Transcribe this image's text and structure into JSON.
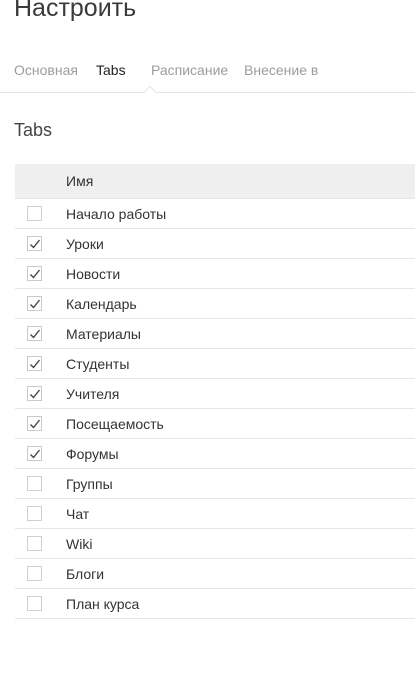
{
  "page": {
    "title": "Настроить"
  },
  "tabs": [
    {
      "label": "Основная",
      "active": false
    },
    {
      "label": "Tabs",
      "active": true
    },
    {
      "label": "Расписание",
      "active": false
    },
    {
      "label": "Внесение в",
      "active": false
    }
  ],
  "section": {
    "title": "Tabs"
  },
  "table": {
    "header": "Имя",
    "rows": [
      {
        "label": "Начало работы",
        "checked": false
      },
      {
        "label": "Уроки",
        "checked": true
      },
      {
        "label": "Новости",
        "checked": true
      },
      {
        "label": "Календарь",
        "checked": true
      },
      {
        "label": "Материалы",
        "checked": true
      },
      {
        "label": "Студенты",
        "checked": true
      },
      {
        "label": "Учителя",
        "checked": true
      },
      {
        "label": "Посещаемость",
        "checked": true
      },
      {
        "label": "Форумы",
        "checked": true
      },
      {
        "label": "Группы",
        "checked": false
      },
      {
        "label": "Чат",
        "checked": false
      },
      {
        "label": "Wiki",
        "checked": false
      },
      {
        "label": "Блоги",
        "checked": false
      },
      {
        "label": "План курса",
        "checked": false
      }
    ]
  }
}
